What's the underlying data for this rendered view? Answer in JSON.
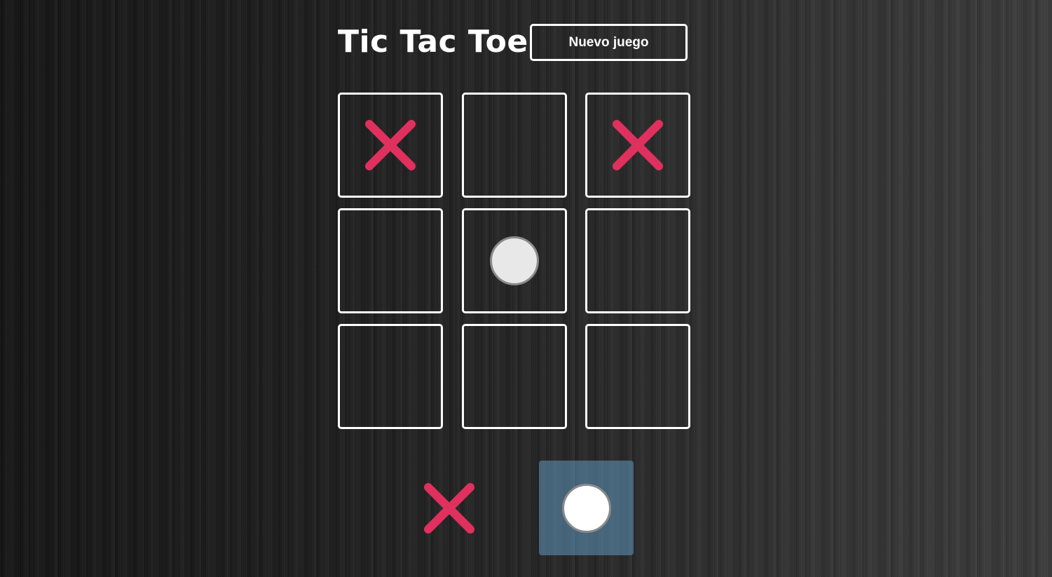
{
  "header": {
    "title": "Tic Tac Toe",
    "new_game_label": "Nuevo juego"
  },
  "board": {
    "cells": [
      "X",
      "",
      "X",
      "",
      "O",
      "",
      "",
      "",
      ""
    ]
  },
  "players": {
    "x": {
      "symbol": "X",
      "icon": "cross-icon",
      "active": false
    },
    "o": {
      "symbol": "O",
      "icon": "circle-icon",
      "active": true
    }
  },
  "colors": {
    "cross": "#e0305e",
    "circle_board": "#e8e8e8",
    "circle_turn": "#ffffff",
    "border": "#ffffff",
    "active_turn": "#5a8fb0"
  }
}
